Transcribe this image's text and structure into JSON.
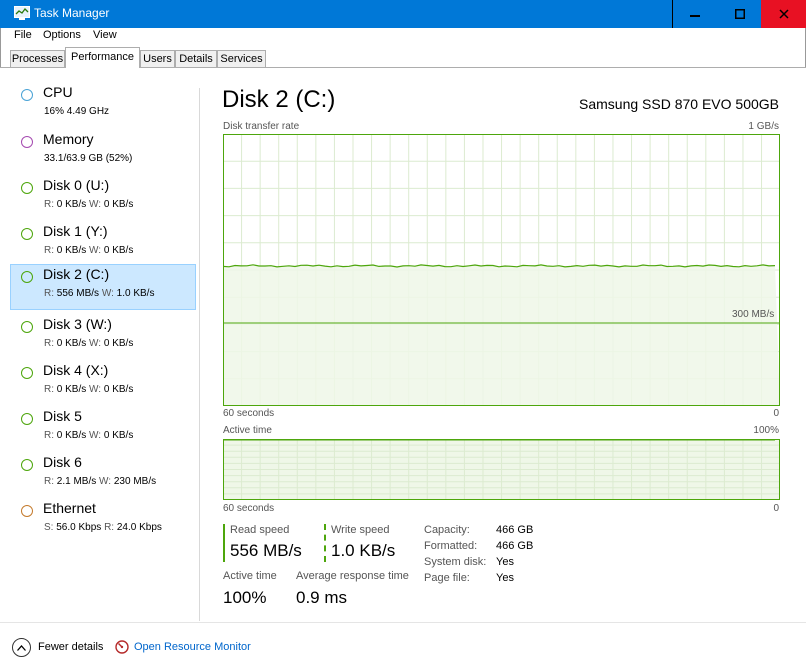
{
  "window": {
    "title": "Task Manager"
  },
  "menu": [
    "File",
    "Options",
    "View"
  ],
  "tabs": [
    "Processes",
    "Performance",
    "Users",
    "Details",
    "Services"
  ],
  "active_tab": "Performance",
  "sidebar": [
    {
      "name": "CPU",
      "line": "16%  4.49 GHz",
      "color": "#4aa3d6"
    },
    {
      "name": "Memory",
      "line": "33.1/63.9 GB (52%)",
      "color": "#a54ab0"
    },
    {
      "name": "Disk 0 (U:)",
      "r": "0 KB/s",
      "w": "0 KB/s",
      "color": "#4da60c"
    },
    {
      "name": "Disk 1 (Y:)",
      "r": "0 KB/s",
      "w": "0 KB/s",
      "color": "#4da60c"
    },
    {
      "name": "Disk 2 (C:)",
      "r": "556 MB/s",
      "w": "1.0 KB/s",
      "color": "#4da60c",
      "selected": true
    },
    {
      "name": "Disk 3 (W:)",
      "r": "0 KB/s",
      "w": "0 KB/s",
      "color": "#4da60c"
    },
    {
      "name": "Disk 4 (X:)",
      "r": "0 KB/s",
      "w": "0 KB/s",
      "color": "#4da60c"
    },
    {
      "name": "Disk 5",
      "r": "0 KB/s",
      "w": "0 KB/s",
      "color": "#4da60c"
    },
    {
      "name": "Disk 6",
      "r": "2.1 MB/s",
      "w": "230 MB/s",
      "color": "#4da60c"
    },
    {
      "name": "Ethernet",
      "s": "56.0 Kbps",
      "rr": "24.0 Kbps",
      "color": "#c47a2c"
    }
  ],
  "sidebar_labels": {
    "r": "R:",
    "w": "W:",
    "s": "S:",
    "rr": "R:"
  },
  "main": {
    "title": "Disk 2 (C:)",
    "device": "Samsung SSD 870 EVO 500GB",
    "graph1": {
      "label": "Disk transfer rate",
      "max_label": "1 GB/s",
      "mid_label": "300 MB/s",
      "time_label": "60 seconds",
      "min_label": "0",
      "series_level": 0.515
    },
    "graph2": {
      "label": "Active time",
      "max_label": "100%",
      "time_label": "60 seconds",
      "min_label": "0",
      "series_level": 1.0
    },
    "stats": {
      "read_label": "Read speed",
      "read_value": "556 MB/s",
      "write_label": "Write speed",
      "write_value": "1.0 KB/s",
      "active_label": "Active time",
      "active_value": "100%",
      "resp_label": "Average response time",
      "resp_value": "0.9 ms"
    },
    "properties": [
      {
        "label": "Capacity:",
        "value": "466 GB"
      },
      {
        "label": "Formatted:",
        "value": "466 GB"
      },
      {
        "label": "System disk:",
        "value": "Yes"
      },
      {
        "label": "Page file:",
        "value": "Yes"
      }
    ]
  },
  "footer": {
    "fewer": "Fewer details",
    "monitor": "Open Resource Monitor"
  },
  "colors": {
    "accent": "#0078d7",
    "disk_line": "#4da60c",
    "disk_fill": "#eff7e8",
    "grid": "#dcebd0"
  }
}
